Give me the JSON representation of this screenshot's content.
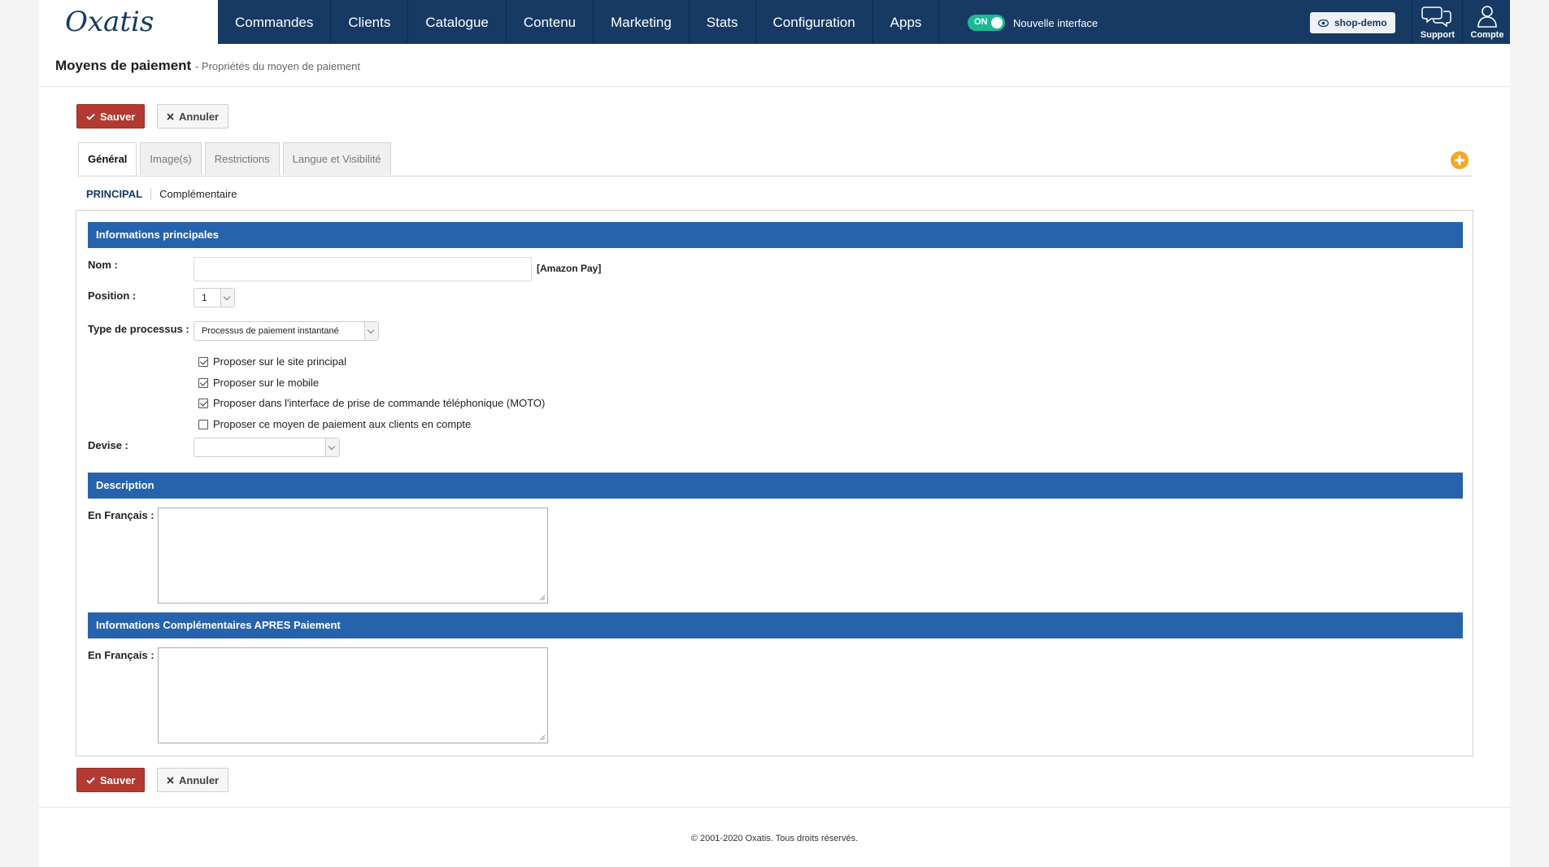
{
  "app": {
    "logo_text": "Oxatis"
  },
  "nav": {
    "items": [
      "Commandes",
      "Clients",
      "Catalogue",
      "Contenu",
      "Marketing",
      "Stats",
      "Configuration",
      "Apps"
    ],
    "toggle_state": "ON",
    "toggle_label": "Nouvelle interface",
    "shop_label": "shop-demo",
    "support_label": "Support",
    "account_label": "Compte"
  },
  "header": {
    "title": "Moyens de paiement",
    "subtitle": "- Propriétés du moyen de paiement"
  },
  "actions": {
    "save_label": "Sauver",
    "cancel_label": "Annuler"
  },
  "tabs": [
    {
      "label": "Général",
      "active": true
    },
    {
      "label": "Image(s)",
      "active": false
    },
    {
      "label": "Restrictions",
      "active": false
    },
    {
      "label": "Langue et Visibilité",
      "active": false
    }
  ],
  "subtabs": [
    {
      "label": "Principal",
      "active": true
    },
    {
      "label": "Complémentaire",
      "active": false
    }
  ],
  "form": {
    "main_section_title": "Informations principales",
    "name_label": "Nom :",
    "name_value": "",
    "name_hint": "[Amazon Pay]",
    "position_label": "Position :",
    "position_value": "1",
    "process_label": "Type de processus :",
    "process_value": "Processus de paiement instantané",
    "checkboxes": [
      {
        "label": "Proposer sur le site principal",
        "checked": true
      },
      {
        "label": "Proposer sur le mobile",
        "checked": true
      },
      {
        "label": "Proposer dans l'interface de prise de commande téléphonique (MOTO)",
        "checked": true
      },
      {
        "label": "Proposer ce moyen de paiement aux clients en compte",
        "checked": false
      }
    ],
    "currency_label": "Devise :",
    "currency_value": "",
    "description_section_title": "Description",
    "description_label": "En Français :",
    "description_value": "",
    "after_payment_section_title": "Informations Complémentaires APRES Paiement",
    "after_payment_label": "En Français :",
    "after_payment_value": ""
  },
  "footer": {
    "copyright": "© 2001-2020 Oxatis. Tous droits réservés."
  },
  "colors": {
    "nav_bg": "#163a63",
    "section_bg": "#2763ad",
    "save_bg": "#b23a31",
    "toggle_on": "#1db893",
    "add_icon": "#f5a623"
  }
}
